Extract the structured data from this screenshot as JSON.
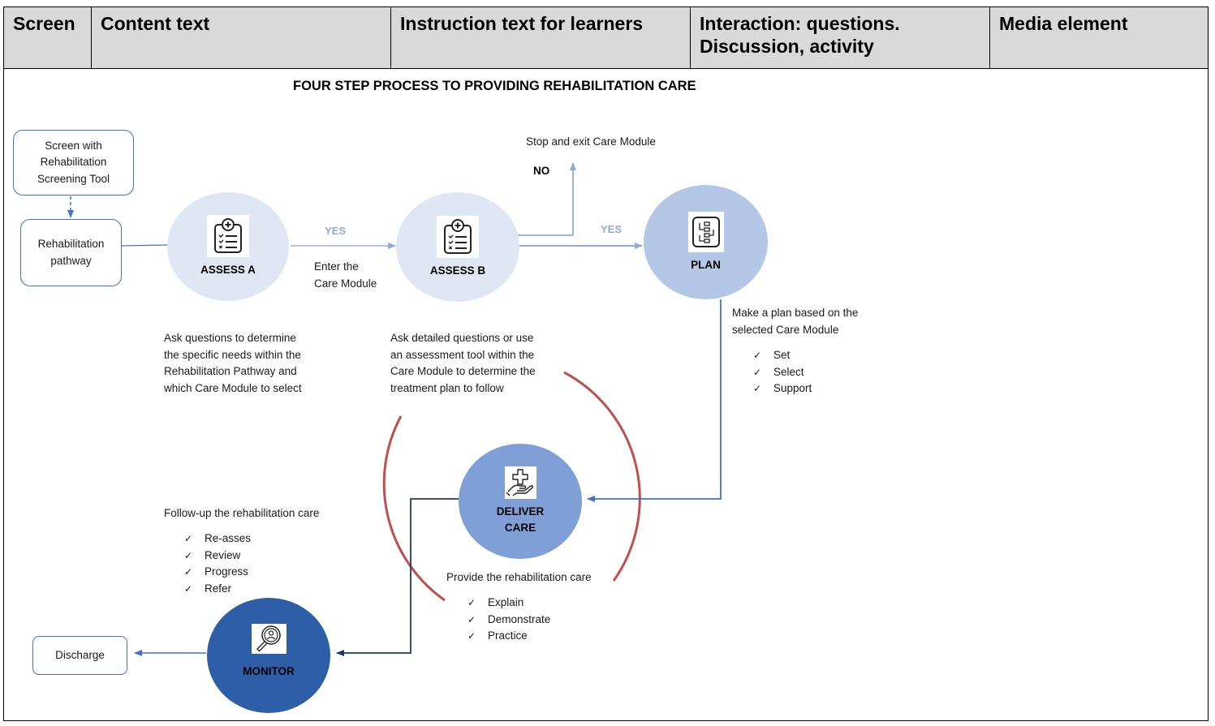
{
  "table": {
    "headers": [
      "Screen",
      "Content text",
      "Instruction text for learners",
      "Interaction: questions. Discussion, activity",
      "Media element"
    ]
  },
  "diagram": {
    "title": "FOUR STEP PROCESS TO PROVIDING REHABILITATION CARE",
    "boxes": {
      "screen_tool": [
        "Screen with",
        "Rehabilitation",
        "Screening Tool"
      ],
      "pathway": [
        "Rehabilitation",
        "pathway"
      ],
      "discharge": "Discharge"
    },
    "nodes": {
      "assess_a": {
        "label": "ASSESS A",
        "icon": "clipboard-checklist-icon",
        "color": "#dfe6f4"
      },
      "assess_b": {
        "label": "ASSESS B",
        "icon": "clipboard-checklist-icon",
        "color": "#dfe6f4"
      },
      "plan": {
        "label": "PLAN",
        "icon": "flowchart-plan-icon",
        "color": "#b4c7e7"
      },
      "deliver": {
        "label_line1": "DELIVER",
        "label_line2": "CARE",
        "icon": "hand-medical-cross-icon",
        "color": "#7f9fd6"
      },
      "monitor": {
        "label": "MONITOR",
        "icon": "magnifier-person-icon",
        "color": "#2f5ea8"
      }
    },
    "edge_labels": {
      "yes_1": "YES",
      "yes_2": "YES",
      "no": "NO",
      "enter_module": [
        "Enter the",
        "Care Module"
      ],
      "stop_exit": "Stop and exit Care Module"
    },
    "descriptions": {
      "assess_a": [
        "Ask questions to determine",
        "the specific needs within the",
        "Rehabilitation Pathway and",
        "which Care Module to select"
      ],
      "assess_b": [
        "Ask detailed questions or use",
        "an assessment tool within the",
        "Care Module to determine the",
        "treatment plan to follow"
      ],
      "plan": {
        "lines": [
          "Make a plan based on the",
          "selected Care Module"
        ],
        "items": [
          "Set",
          "Select",
          "Support"
        ]
      },
      "deliver": {
        "line": "Provide the rehabilitation care",
        "items": [
          "Explain",
          "Demonstrate",
          "Practice"
        ]
      },
      "monitor": {
        "line": "Follow-up the rehabilitation care",
        "items": [
          "Re-asses",
          "Review",
          "Progress",
          "Refer"
        ]
      }
    },
    "check_glyph": "✓",
    "colors": {
      "arrow_light": "#8faadc",
      "arrow_mid": "#4472c4",
      "arrow_dark": "#203864",
      "cycle_arc": "#c0504d"
    }
  }
}
